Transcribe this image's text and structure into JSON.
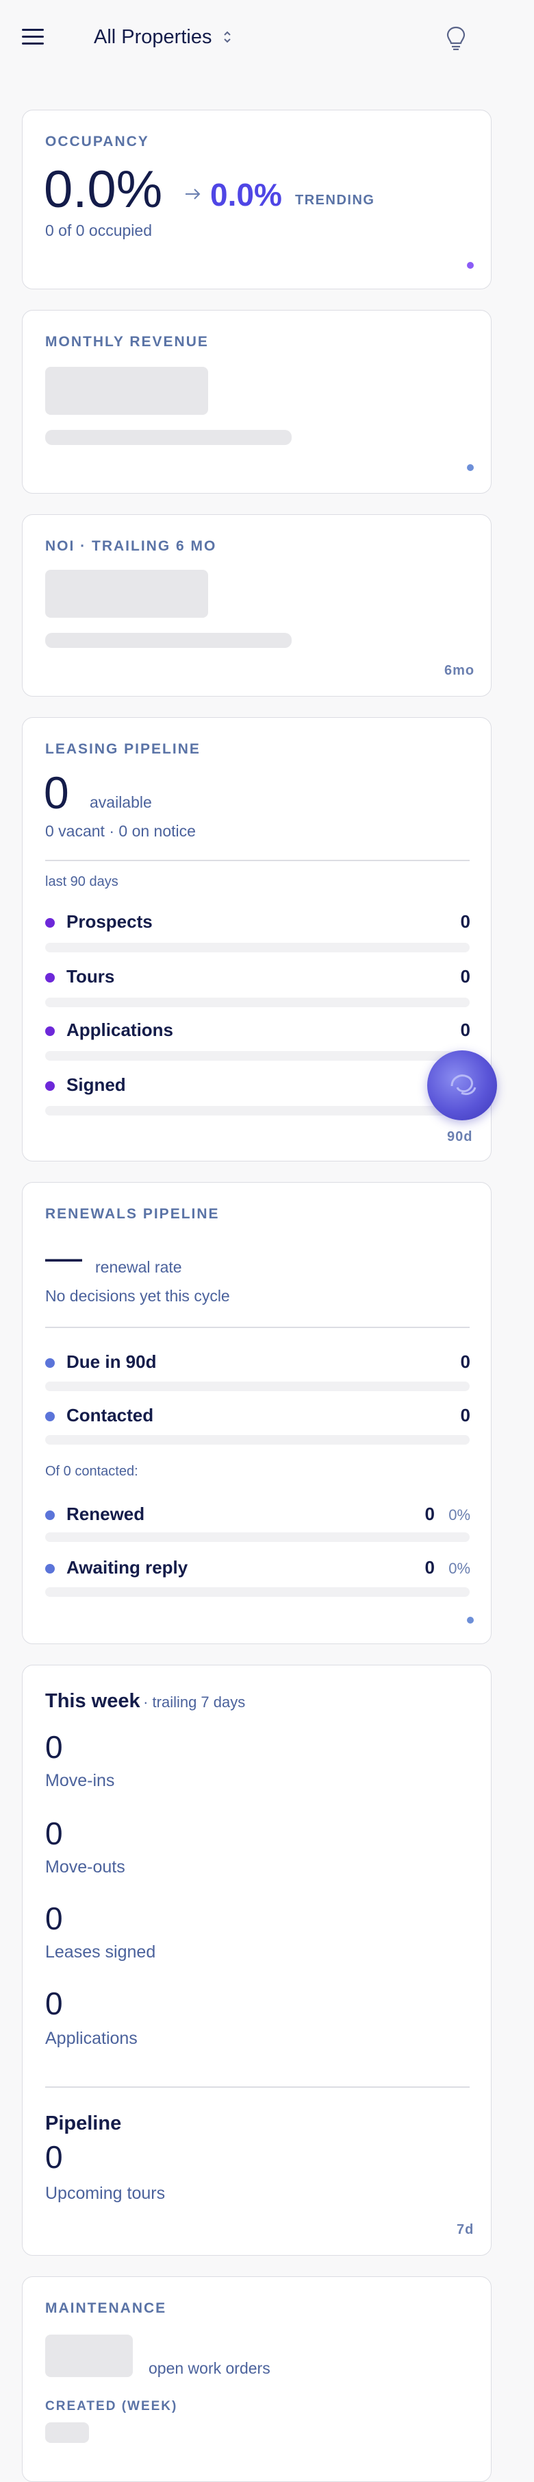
{
  "header": {
    "property_selector": "All Properties",
    "menu_icon": "hamburger-icon",
    "bulb_icon": "lightbulb-icon"
  },
  "occupancy": {
    "label": "OCCUPANCY",
    "value": "0.0%",
    "trend_value": "0.0%",
    "trend_label": "TRENDING",
    "detail": "0 of 0 occupied"
  },
  "revenue": {
    "label": "MONTHLY REVENUE"
  },
  "noi": {
    "label": "NOI · TRAILING 6 MO",
    "period": "6mo"
  },
  "leasing": {
    "label": "LEASING PIPELINE",
    "available_count": "0",
    "available_label": "available",
    "detail": "0 vacant · 0 on notice",
    "window": "last 90 days",
    "rows": [
      {
        "label": "Prospects",
        "value": "0"
      },
      {
        "label": "Tours",
        "value": "0"
      },
      {
        "label": "Applications",
        "value": "0"
      },
      {
        "label": "Signed",
        "value": ""
      }
    ],
    "period": "90d"
  },
  "renewals": {
    "label": "RENEWALS PIPELINE",
    "rate": "—",
    "rate_label": "renewal rate",
    "detail": "No decisions yet this cycle",
    "rows": [
      {
        "label": "Due in 90d",
        "value": "0"
      },
      {
        "label": "Contacted",
        "value": "0"
      }
    ],
    "contacted_note": "Of 0 contacted:",
    "outcome_rows": [
      {
        "label": "Renewed",
        "value": "0",
        "pct": "0%"
      },
      {
        "label": "Awaiting reply",
        "value": "0",
        "pct": "0%"
      }
    ]
  },
  "week": {
    "title": "This week",
    "subtitle": "· trailing 7 days",
    "stats": [
      {
        "value": "0",
        "label": "Move-ins"
      },
      {
        "value": "0",
        "label": "Move-outs"
      },
      {
        "value": "0",
        "label": "Leases signed"
      },
      {
        "value": "0",
        "label": "Applications"
      }
    ],
    "pipeline_title": "Pipeline",
    "pipeline_value": "0",
    "pipeline_label": "Upcoming tours",
    "period": "7d"
  },
  "maintenance": {
    "label": "MAINTENANCE",
    "open_label": "open work orders",
    "created_label": "CREATED (WEEK)"
  },
  "colors": {
    "accent": "#4f46e5",
    "leasing_dot": "#6d28d9",
    "renewal_dot": "#5b74d9"
  }
}
